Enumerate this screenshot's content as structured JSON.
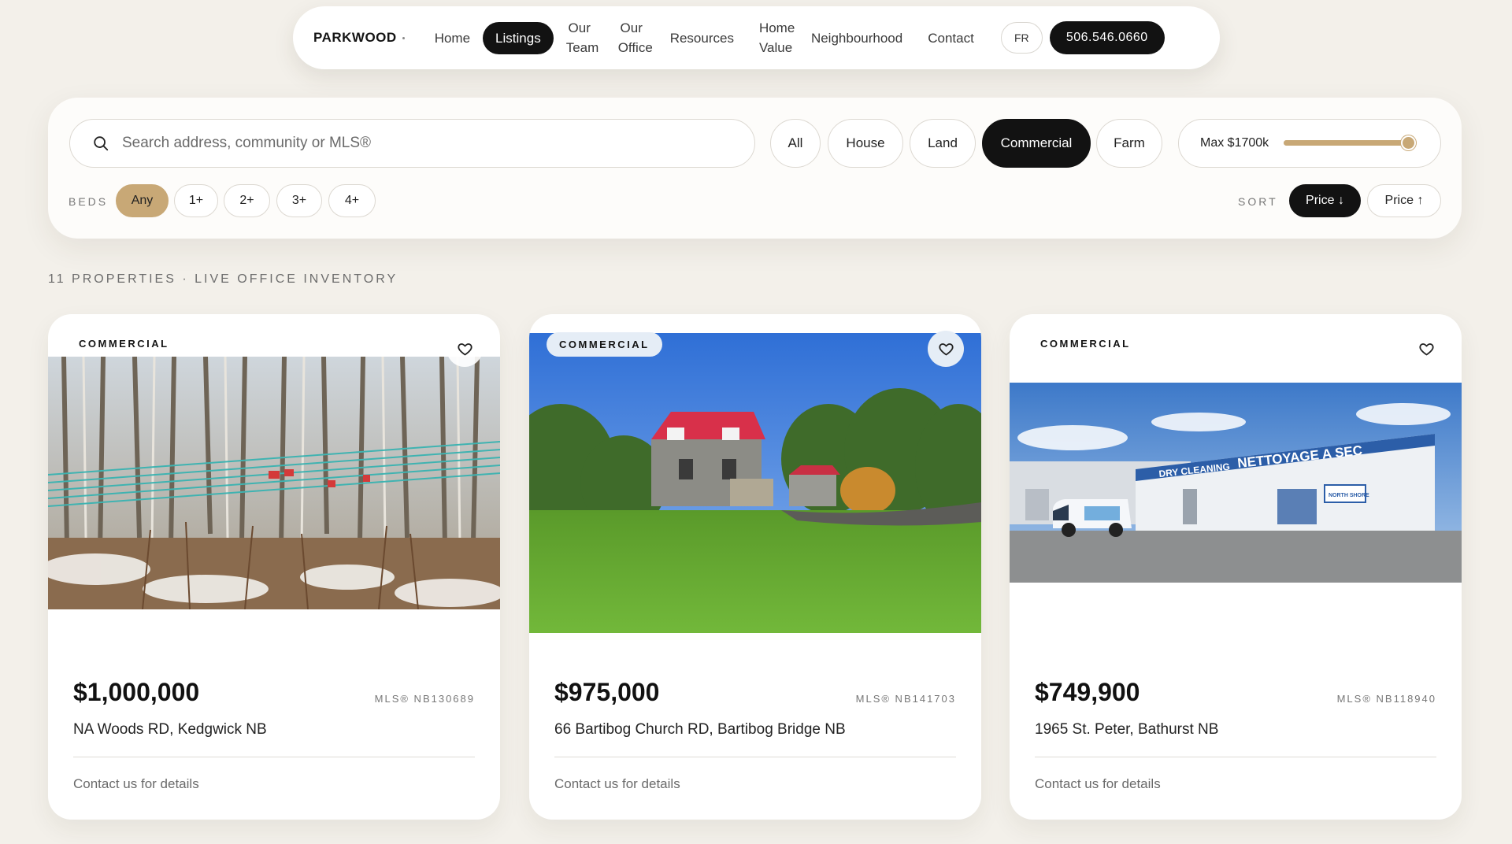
{
  "nav": {
    "logo": "PARKWOOD",
    "links": [
      "Home",
      "Listings",
      "Our Team",
      "Our Office",
      "Resources",
      "Home Value",
      "Neighbourhood",
      "Contact"
    ],
    "active": "Listings",
    "lang": "FR",
    "phone": "506.546.0660"
  },
  "filters": {
    "search_placeholder": "Search address, community or MLS®",
    "types": [
      "All",
      "House",
      "Land",
      "Commercial",
      "Farm"
    ],
    "active_type": "Commercial",
    "max_price_label": "Max $1700k",
    "max_price_fraction": 1.0,
    "beds_label": "BEDS",
    "beds": [
      "Any",
      "1+",
      "2+",
      "3+",
      "4+"
    ],
    "active_beds": "Any",
    "sort_label": "SORT",
    "sort_options": [
      "Price ↓",
      "Price ↑"
    ],
    "active_sort": "Price ↓"
  },
  "results": {
    "count_label": "11 PROPERTIES · LIVE OFFICE INVENTORY"
  },
  "listings": [
    {
      "type": "COMMERCIAL",
      "price": "$1,000,000",
      "mls": "MLS® NB130689",
      "address": "NA Woods RD, Kedgwick NB",
      "details": "Contact us for details",
      "photo_icon": "wooded-lot-photo"
    },
    {
      "type": "COMMERCIAL",
      "price": "$975,000",
      "mls": "MLS® NB141703",
      "address": "66 Bartibog Church RD, Bartibog Bridge NB",
      "details": "Contact us for details",
      "photo_icon": "red-roof-house-photo"
    },
    {
      "type": "COMMERCIAL",
      "price": "$749,900",
      "mls": "MLS® NB118940",
      "address": "1965 St. Peter, Bathurst NB",
      "details": "Contact us for details",
      "photo_icon": "dry-cleaning-storefront-photo",
      "sign_text": [
        "DRY CLEANING",
        "NETTOYAGE A SEC",
        "NORTH SHORE"
      ]
    }
  ],
  "colors": {
    "background": "#f3f0ea",
    "accent_gold": "#c8a876",
    "dark": "#121212",
    "chip_blue": "#e5edf6"
  }
}
